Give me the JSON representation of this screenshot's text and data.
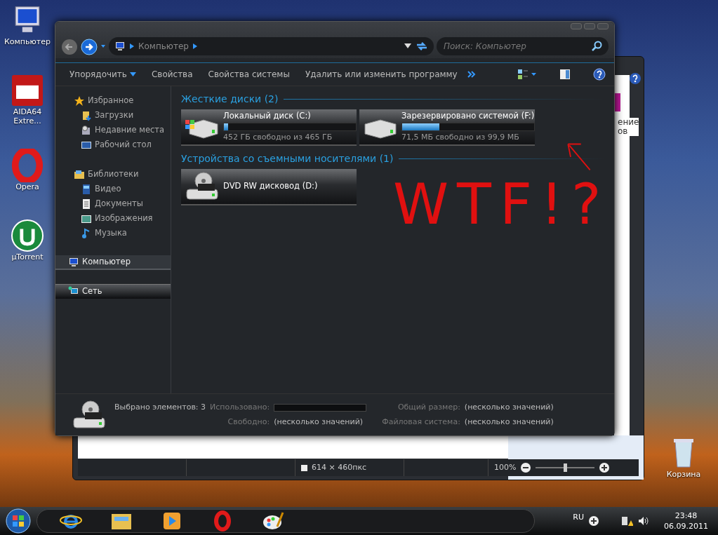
{
  "desktop_icons": [
    {
      "label": "Компьютер",
      "kind": "computer"
    },
    {
      "label": "AIDA64 Extre...",
      "kind": "aida"
    },
    {
      "label": "Opera",
      "kind": "opera"
    },
    {
      "label": "µTorrent",
      "kind": "torrent"
    }
  ],
  "recycle_bin": {
    "label": "Корзина"
  },
  "background_window": {
    "fragments": [
      "ение",
      "ов"
    ],
    "image_size": "614 × 460пкс",
    "zoom": "100%",
    "zoom_slider": {
      "level": 0.5
    }
  },
  "explorer": {
    "address": "Компьютер",
    "search": {
      "placeholder": "Поиск: Компьютер"
    },
    "toolbar": [
      {
        "label": "Упорядочить",
        "dropdown": true
      },
      {
        "label": "Свойства",
        "dropdown": false
      },
      {
        "label": "Свойства системы",
        "dropdown": false
      },
      {
        "label": "Удалить или изменить программу",
        "dropdown": false
      }
    ],
    "sidebar": [
      {
        "label": "Избранное",
        "kind": "star",
        "selected": false,
        "hovered": false,
        "children": [
          {
            "label": "Загрузки",
            "kind": "downloads"
          },
          {
            "label": "Недавние места",
            "kind": "recent"
          },
          {
            "label": "Рабочий стол",
            "kind": "desktop"
          }
        ]
      },
      {
        "label": "Библиотеки",
        "kind": "library",
        "selected": false,
        "hovered": false,
        "children": [
          {
            "label": "Видео",
            "kind": "video"
          },
          {
            "label": "Документы",
            "kind": "documents"
          },
          {
            "label": "Изображения",
            "kind": "pictures"
          },
          {
            "label": "Музыка",
            "kind": "music"
          }
        ]
      },
      {
        "label": "Компьютер",
        "kind": "computer",
        "selected": true,
        "hovered": false
      },
      {
        "label": "Сеть",
        "kind": "network",
        "selected": false,
        "hovered": true
      }
    ],
    "groups": [
      {
        "title": "Жесткие диски (2)",
        "items": [
          {
            "name": "Локальный диск (C:)",
            "kind": "hdd-windows",
            "level": 0.03,
            "free": "452 ГБ свободно из 465 ГБ"
          },
          {
            "name": "Зарезервировано системой (F:)",
            "kind": "hdd",
            "level": 0.28,
            "free": "71,5 МБ свободно из 99,9 МБ"
          }
        ]
      },
      {
        "title": "Устройства со съемными носителями (1)",
        "items": [
          {
            "name": "DVD RW дисковод (D:)",
            "kind": "dvd"
          }
        ]
      }
    ],
    "details": {
      "summary": "Выбрано элементов: 3",
      "fields": [
        {
          "label": "Использовано:",
          "kind": "bar"
        },
        {
          "label": "Общий размер:",
          "kind": "text",
          "value": "(несколько значений)"
        },
        {
          "label": "Свободно:",
          "kind": "text",
          "value": "(несколько значений)"
        },
        {
          "label": "Файловая система:",
          "kind": "text",
          "value": "(несколько значений)"
        }
      ]
    }
  },
  "annotation": {
    "text": "WTF!?"
  },
  "taskbar": {
    "items": [
      {
        "kind": "ie"
      },
      {
        "kind": "explorer"
      },
      {
        "kind": "media"
      },
      {
        "kind": "opera"
      },
      {
        "kind": "paint"
      }
    ],
    "language": "RU",
    "time": "23:48",
    "date": "06.09.2011"
  }
}
